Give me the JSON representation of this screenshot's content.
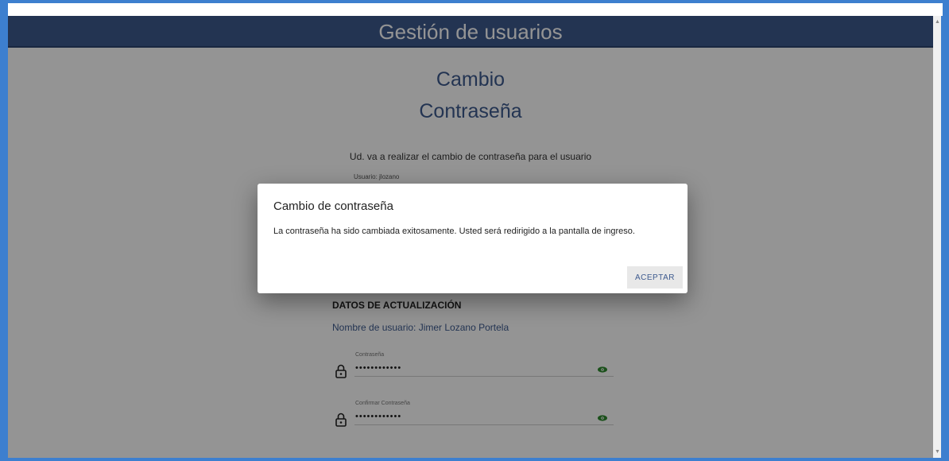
{
  "header": {
    "title": "Gestión de usuarios"
  },
  "page": {
    "title_line1": "Cambio",
    "title_line2": "Contraseña",
    "intro": "Ud. va a realizar el cambio de contraseña para el usuario",
    "user_small": "Usuario: jlozano",
    "section_heading": "DATOS DE ACTUALIZACIÓN",
    "username_line": "Nombre de usuario: Jimer Lozano Portela"
  },
  "fields": {
    "password": {
      "label": "Contraseña",
      "value": "••••••••••••"
    },
    "confirm": {
      "label": "Confirmar Contraseña",
      "value": "••••••••••••"
    }
  },
  "dialog": {
    "title": "Cambio de contraseña",
    "message": "La contraseña ha sido cambiada exitosamente. Usted será redirigido a la pantalla de ingreso.",
    "accept_label": "ACEPTAR"
  },
  "colors": {
    "accent": "#3d5a8e",
    "eye": "#2e8b2e",
    "window_border": "#3d7fcf"
  },
  "icons": {
    "lock": "lock-icon",
    "eye": "eye-icon"
  }
}
